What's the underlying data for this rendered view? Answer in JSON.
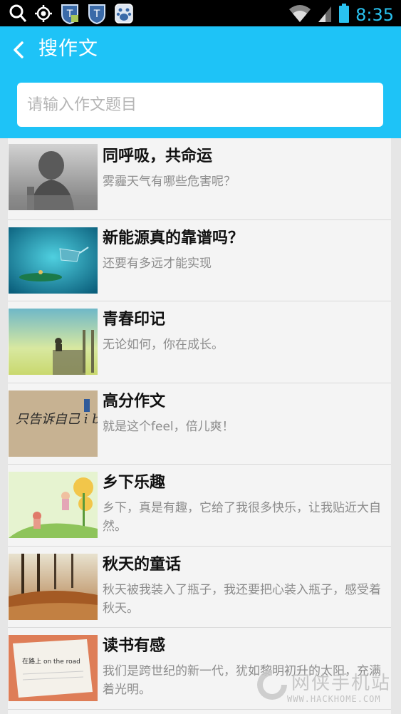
{
  "status_bar": {
    "time": "8:35"
  },
  "header": {
    "title": "搜作文",
    "search_placeholder": "请输入作文题目"
  },
  "items": [
    {
      "title": "同呼吸，共命运",
      "desc": "雾霾天气有哪些危害呢？",
      "thumb_text": ""
    },
    {
      "title": "新能源真的靠谱吗？",
      "desc": "还要有多远才能实现",
      "thumb_text": ""
    },
    {
      "title": "青春印记",
      "desc": "无论如何，你在成长。",
      "thumb_text": ""
    },
    {
      "title": "高分作文",
      "desc": "就是这个feel，倍儿爽！",
      "thumb_text": "只告诉自己 i believe."
    },
    {
      "title": "乡下乐趣",
      "desc": "乡下，真是有趣，它给了我很多快乐，让我贴近大自然。",
      "thumb_text": ""
    },
    {
      "title": "秋天的童话",
      "desc": "秋天被我装入了瓶子，我还要把心装入瓶子，感受着秋天。",
      "thumb_text": ""
    },
    {
      "title": "读书有感",
      "desc": "我们是跨世纪的新一代，犹如黎明初升的太阳，充满着光明。",
      "thumb_text": "在路上 on the road"
    }
  ],
  "watermark": {
    "name": "网侠手机站",
    "url": "WWW.HACKHOME.COM"
  },
  "colors": {
    "header": "#1ec3f7",
    "time": "#29c2f0"
  }
}
